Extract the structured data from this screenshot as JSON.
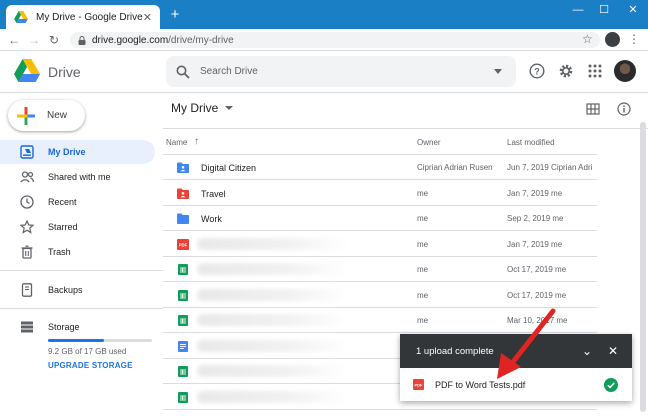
{
  "browser": {
    "tab_title": "My Drive - Google Drive",
    "url_host": "drive.google.com",
    "url_path": "/drive/my-drive"
  },
  "app": {
    "name": "Drive",
    "search_placeholder": "Search Drive"
  },
  "sidebar": {
    "new_label": "New",
    "items": [
      {
        "label": "My Drive",
        "icon": "my-drive-icon",
        "active": true
      },
      {
        "label": "Shared with me",
        "icon": "shared-icon"
      },
      {
        "label": "Recent",
        "icon": "clock-icon"
      },
      {
        "label": "Starred",
        "icon": "star-icon"
      },
      {
        "label": "Trash",
        "icon": "trash-icon"
      },
      {
        "label": "Backups",
        "icon": "backup-icon"
      },
      {
        "label": "Storage",
        "icon": "storage-icon"
      }
    ],
    "storage": {
      "used_text": "9.2 GB of 17 GB used",
      "used_fraction": 0.54,
      "upgrade_label": "UPGRADE STORAGE"
    }
  },
  "main": {
    "title": "My Drive",
    "columns": {
      "name": "Name",
      "owner": "Owner",
      "modified": "Last modified"
    },
    "rows": [
      {
        "type": "folder-shared",
        "name": "Digital Citizen",
        "owner": "Ciprian Adrian Rusen",
        "modified": "Jun 7, 2019",
        "modified_by": "Ciprian Adri"
      },
      {
        "type": "folder-red",
        "name": "Travel",
        "owner": "me",
        "modified": "Jan 7, 2019",
        "modified_by": "me"
      },
      {
        "type": "folder",
        "name": "Work",
        "owner": "me",
        "modified": "Sep 2, 2019",
        "modified_by": "me"
      },
      {
        "type": "pdf",
        "name": "",
        "owner": "me",
        "modified": "Jan 7, 2019",
        "modified_by": "me"
      },
      {
        "type": "sheet",
        "name": "",
        "owner": "me",
        "modified": "Oct 17, 2019",
        "modified_by": "me"
      },
      {
        "type": "sheet",
        "name": "",
        "owner": "me",
        "modified": "Oct 17, 2019",
        "modified_by": "me"
      },
      {
        "type": "sheet",
        "name": "",
        "owner": "me",
        "modified": "Mar 10, 2017",
        "modified_by": "me"
      },
      {
        "type": "doc",
        "name": "",
        "owner": "",
        "modified": "",
        "modified_by": ""
      },
      {
        "type": "sheet",
        "name": "",
        "owner": "",
        "modified": "",
        "modified_by": ""
      },
      {
        "type": "sheet",
        "name": "",
        "owner": "",
        "modified": "",
        "modified_by": ""
      }
    ]
  },
  "upload": {
    "title": "1 upload complete",
    "file_name": "PDF to Word Tests.pdf"
  },
  "colors": {
    "accent": "#1a73e8",
    "titlebar": "#1a7fc4",
    "active_nav_bg": "#e8f0fe",
    "upload_header": "#323639",
    "annotation": "#e02424"
  }
}
